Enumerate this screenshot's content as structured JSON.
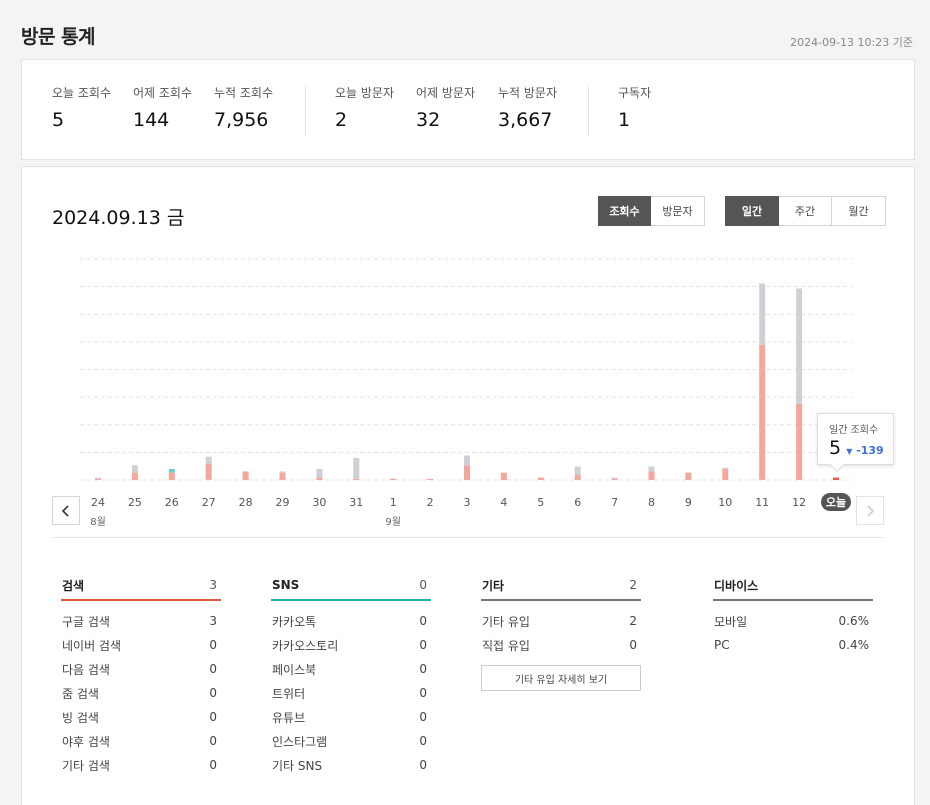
{
  "page": {
    "title": "방문 통계",
    "updated": "2024-09-13 10:23 기준"
  },
  "summary": [
    {
      "label": "오늘 조회수",
      "value": "5"
    },
    {
      "label": "어제 조회수",
      "value": "144"
    },
    {
      "label": "누적 조회수",
      "value": "7,956"
    },
    {
      "label": "오늘 방문자",
      "value": "2"
    },
    {
      "label": "어제 방문자",
      "value": "32"
    },
    {
      "label": "누적 방문자",
      "value": "3,667"
    },
    {
      "label": "구독자",
      "value": "1"
    }
  ],
  "chart_header": {
    "date": "2024.09.13 금",
    "metric_tabs": [
      "조회수",
      "방문자"
    ],
    "period_tabs": [
      "일간",
      "주간",
      "월간"
    ]
  },
  "tooltip": {
    "label": "일간 조회수",
    "value": "5",
    "diff": "-139",
    "diff_arrow": "▼"
  },
  "colors": {
    "referral": "#f4a79c",
    "other": "#cdd1d6",
    "sns": "#6ccfc7",
    "today": "#e55b4b",
    "search_line": "#e5533d",
    "sns_line": "#1ab39f",
    "neutral_line": "#888888"
  },
  "chart_data": {
    "type": "bar",
    "stacked": true,
    "categories": [
      "24",
      "25",
      "26",
      "27",
      "28",
      "29",
      "30",
      "31",
      "1",
      "2",
      "3",
      "4",
      "5",
      "6",
      "7",
      "8",
      "9",
      "10",
      "11",
      "12",
      "오늘"
    ],
    "month_labels": [
      {
        "index": 0,
        "label": "8월"
      },
      {
        "index": 8,
        "label": "9월"
      }
    ],
    "series": [
      {
        "color": "#f4a79c",
        "values": [
          1,
          6,
          6,
          13,
          7,
          6,
          2,
          1,
          1,
          1,
          12,
          6,
          2,
          4,
          1,
          7,
          6,
          9,
          110,
          62,
          2
        ]
      },
      {
        "color": "#6ccfc7",
        "values": [
          0,
          0,
          3,
          0,
          0,
          0,
          0,
          0,
          0,
          0,
          0,
          0,
          0,
          0,
          0,
          0,
          0,
          0,
          0,
          0,
          0
        ]
      },
      {
        "color": "#cdd1d6",
        "values": [
          1,
          6,
          0,
          6,
          0,
          1,
          7,
          17,
          0,
          0,
          8,
          0,
          0,
          7,
          1,
          4,
          0,
          1,
          50,
          94,
          0
        ]
      }
    ],
    "ylim": [
      0,
      180
    ],
    "grid": true
  },
  "categories": [
    {
      "name": "검색",
      "count": "3",
      "line": "#e5533d",
      "rows": [
        [
          "구글 검색",
          "3"
        ],
        [
          "네이버 검색",
          "0"
        ],
        [
          "다음 검색",
          "0"
        ],
        [
          "줌 검색",
          "0"
        ],
        [
          "빙 검색",
          "0"
        ],
        [
          "야후 검색",
          "0"
        ],
        [
          "기타 검색",
          "0"
        ]
      ]
    },
    {
      "name": "SNS",
      "count": "0",
      "line": "#1ab39f",
      "rows": [
        [
          "카카오톡",
          "0"
        ],
        [
          "카카오스토리",
          "0"
        ],
        [
          "페이스북",
          "0"
        ],
        [
          "트위터",
          "0"
        ],
        [
          "유튜브",
          "0"
        ],
        [
          "인스타그램",
          "0"
        ],
        [
          "기타 SNS",
          "0"
        ]
      ]
    },
    {
      "name": "기타",
      "count": "2",
      "line": "#888888",
      "rows": [
        [
          "기타 유입",
          "2"
        ],
        [
          "직접 유입",
          "0"
        ]
      ],
      "button": "기타 유입 자세히 보기"
    },
    {
      "name": "디바이스",
      "count": "",
      "line": "#888888",
      "rows": [
        [
          "모바일",
          "0.6%"
        ],
        [
          "PC",
          "0.4%"
        ]
      ]
    }
  ]
}
